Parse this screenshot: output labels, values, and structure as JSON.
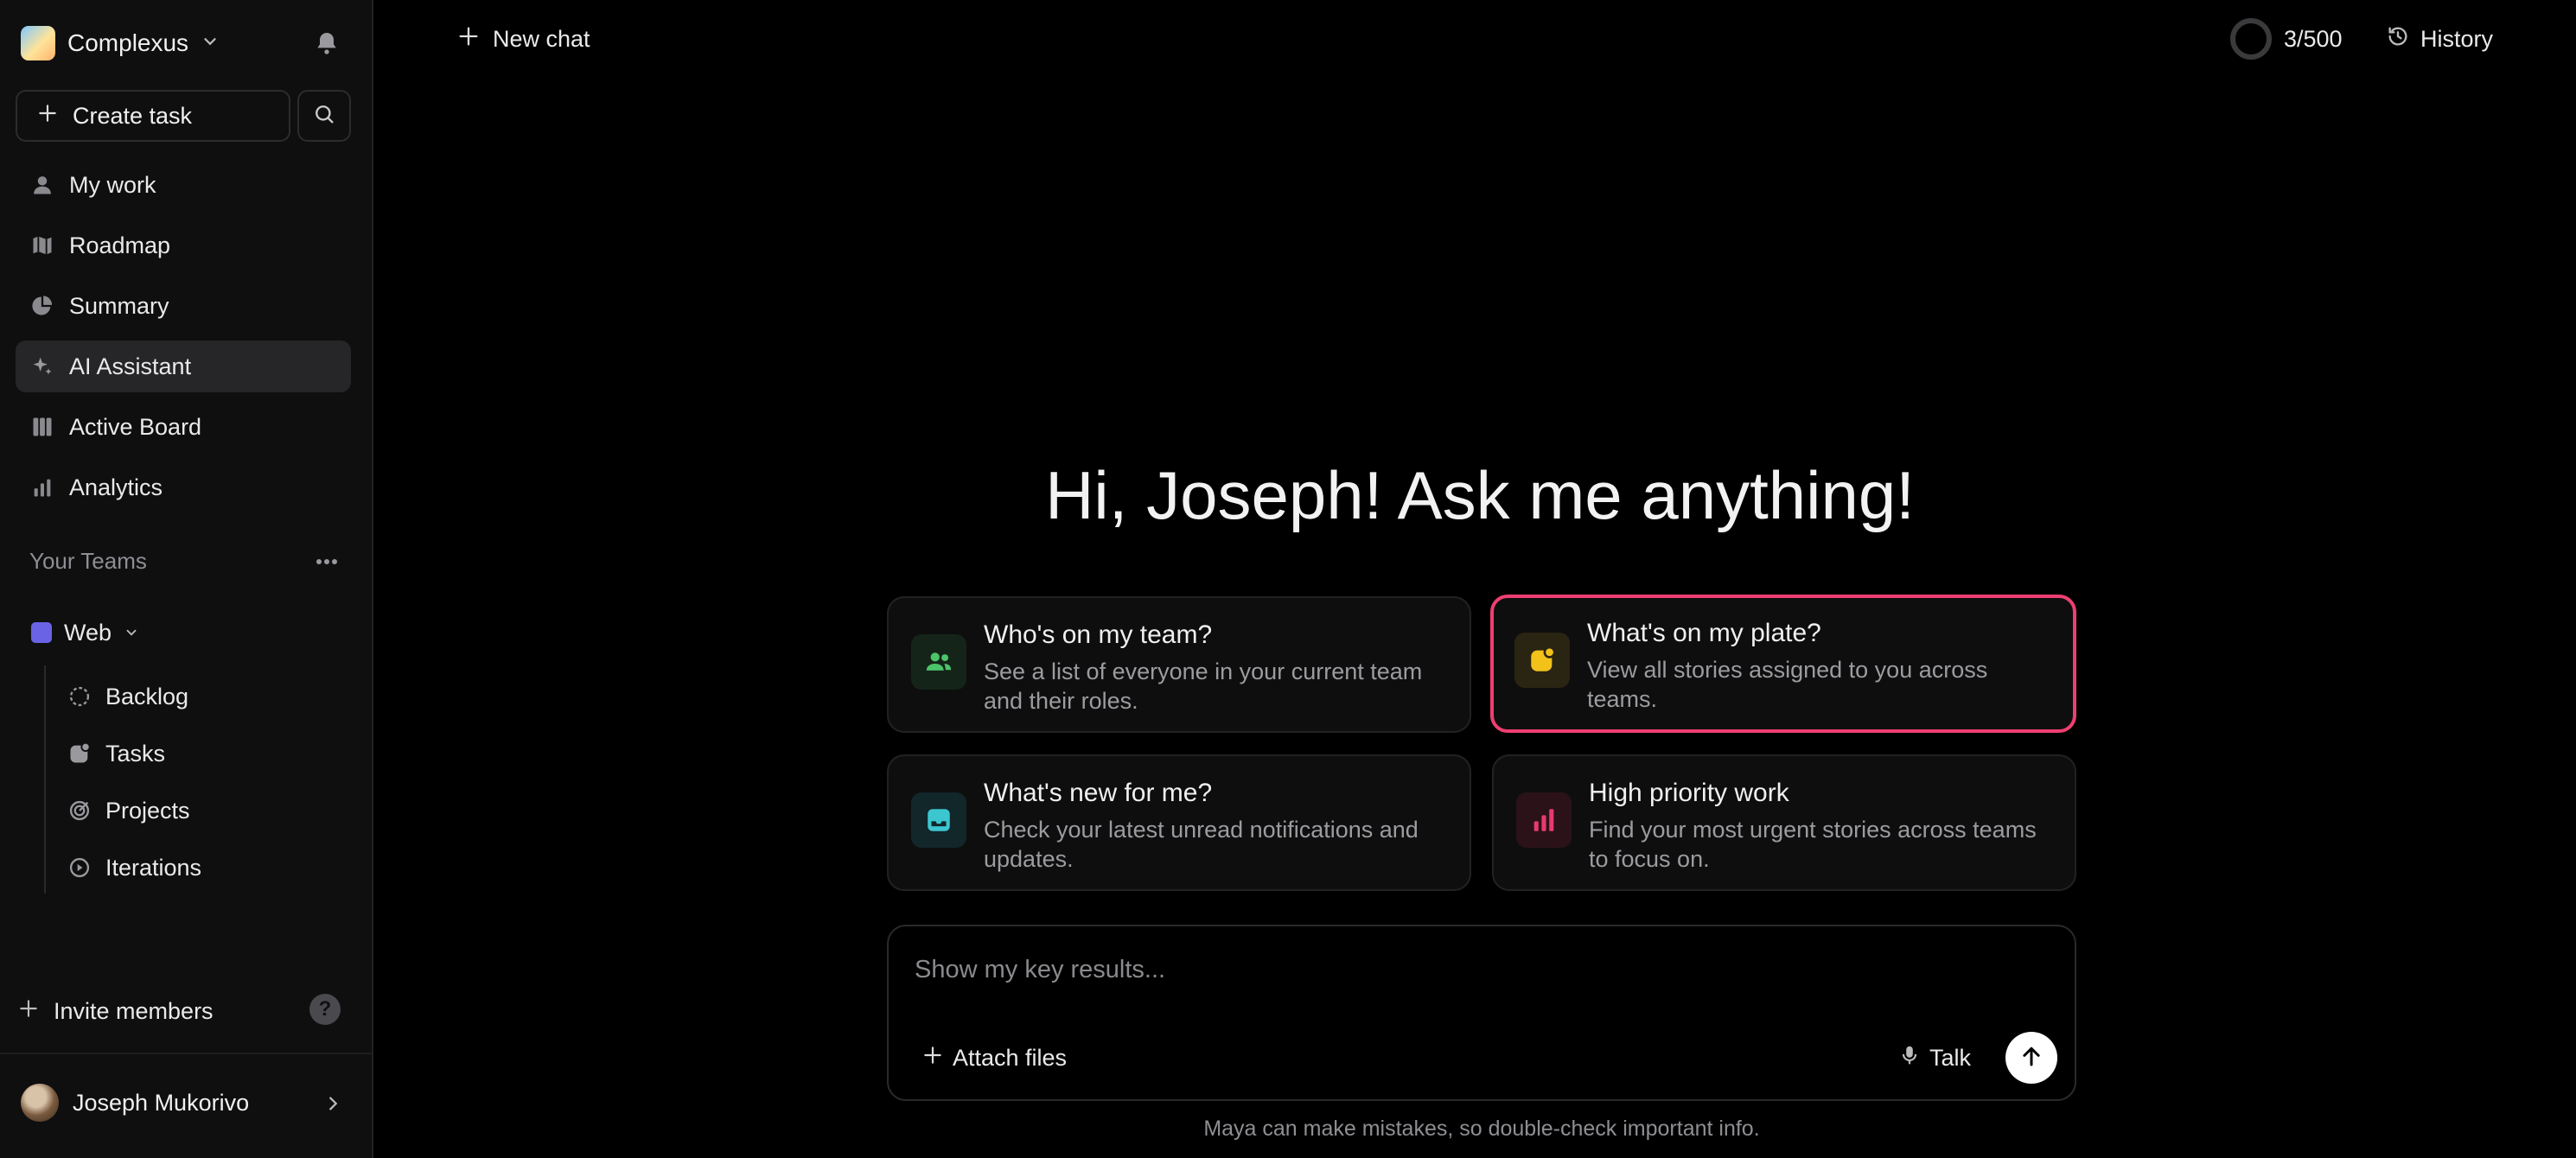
{
  "sidebar": {
    "workspace": "Complexus",
    "create_task": "Create task",
    "nav": [
      {
        "label": "My work",
        "icon": "person-icon"
      },
      {
        "label": "Roadmap",
        "icon": "map-icon"
      },
      {
        "label": "Summary",
        "icon": "pie-chart-icon"
      },
      {
        "label": "AI Assistant",
        "icon": "sparkles-icon",
        "active": true
      },
      {
        "label": "Active Board",
        "icon": "board-icon"
      },
      {
        "label": "Analytics",
        "icon": "bar-chart-icon"
      }
    ],
    "teams_label": "Your Teams",
    "team": {
      "name": "Web",
      "color": "#6a63e6"
    },
    "team_items": [
      {
        "label": "Backlog",
        "icon": "dashed-circle-icon"
      },
      {
        "label": "Tasks",
        "icon": "tasks-icon"
      },
      {
        "label": "Projects",
        "icon": "target-icon"
      },
      {
        "label": "Iterations",
        "icon": "play-circle-icon"
      }
    ],
    "invite": "Invite members",
    "help": "?",
    "user": "Joseph Mukorivo"
  },
  "topbar": {
    "new_chat": "New chat",
    "quota": "3/500",
    "history": "History"
  },
  "main": {
    "greeting": "Hi, Joseph! Ask me anything!",
    "cards": [
      {
        "title": "Who's on my team?",
        "desc": "See a list of everyone in your current team and their roles.",
        "icon": "users-icon",
        "color": "#4cc46a"
      },
      {
        "title": "What's on my plate?",
        "desc": "View all stories assigned to you across teams.",
        "icon": "plate-icon",
        "color": "#f2c21b"
      },
      {
        "title": "What's new for me?",
        "desc": "Check your latest unread notifications and updates.",
        "icon": "inbox-icon",
        "color": "#3cc6d0"
      },
      {
        "title": "High priority work",
        "desc": "Find your most urgent stories across teams to focus on.",
        "icon": "priority-icon",
        "color": "#e83a6e"
      }
    ],
    "composer": {
      "placeholder": "Show my key results...",
      "attach": "Attach files",
      "talk": "Talk"
    },
    "disclaimer": "Maya can make mistakes, so double-check important info."
  },
  "colors": {
    "highlight": "#ee3f72",
    "background": "#000000"
  }
}
